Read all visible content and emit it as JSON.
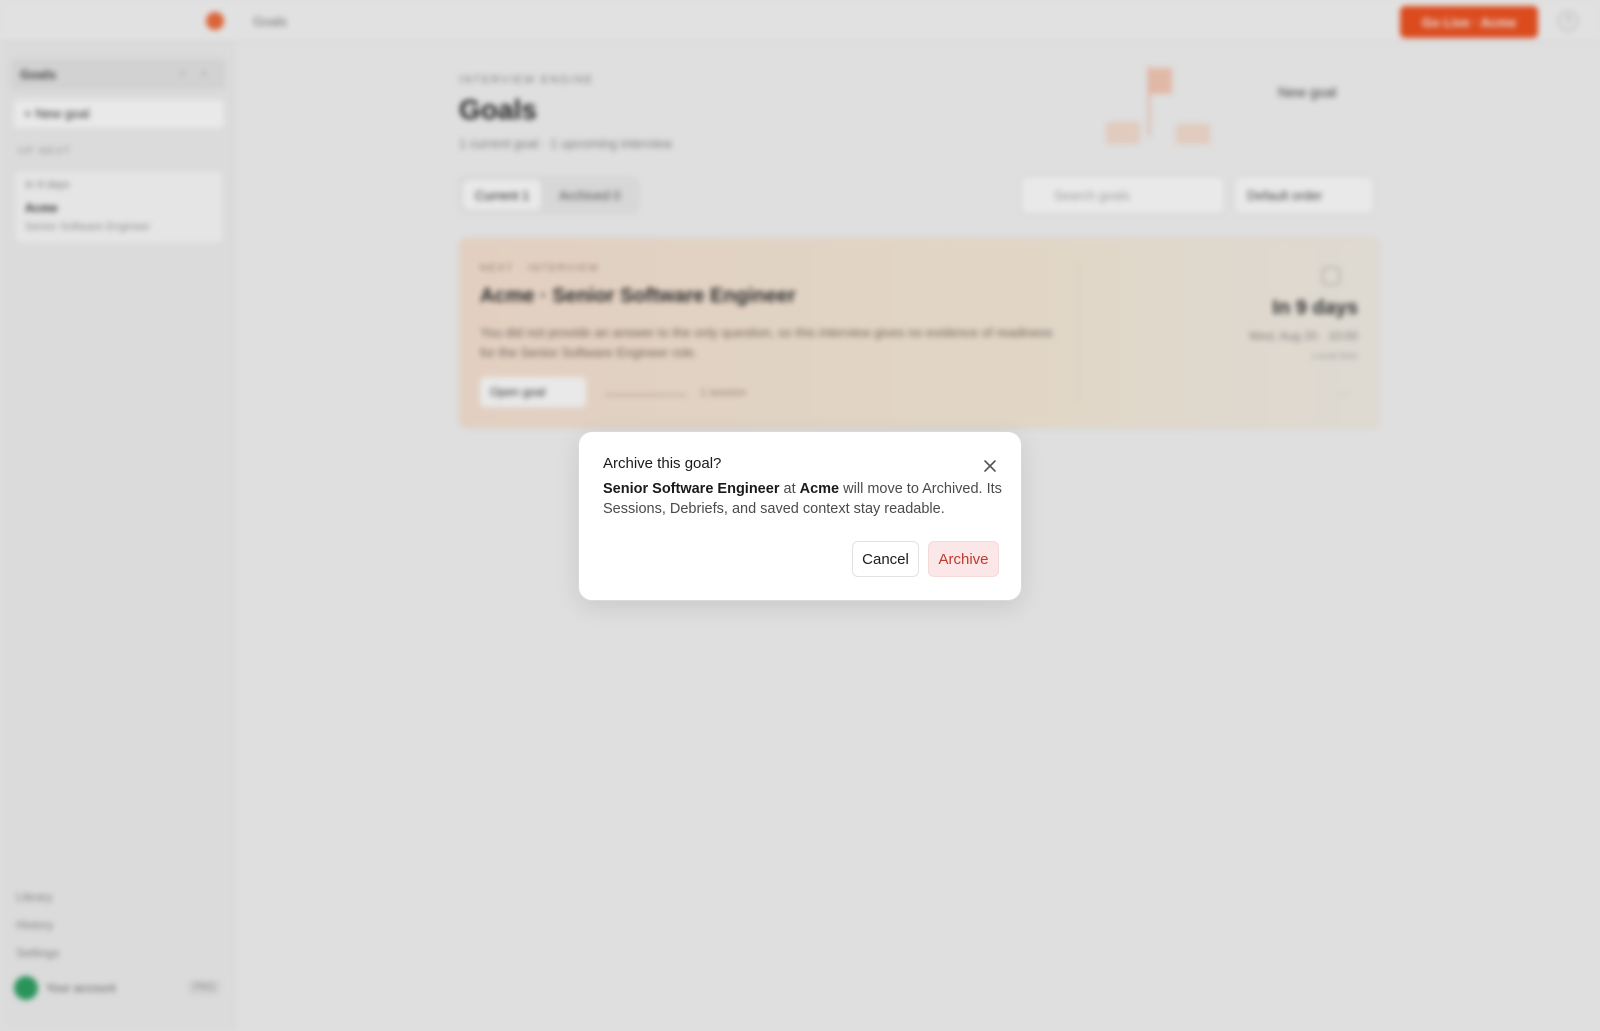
{
  "topbar": {
    "breadcrumb": "Goals",
    "cta_label": "Go Live · Acme",
    "help_icon": "?"
  },
  "sidebar": {
    "header_title": "Goals",
    "new_goal": "+ New goal",
    "section_label": "UP NEXT",
    "card": {
      "days": "In 9 days",
      "company": "Acme",
      "role": "Senior Software Engineer"
    },
    "footer_items": [
      {
        "label": "Library"
      },
      {
        "label": "History"
      },
      {
        "label": "Settings"
      }
    ],
    "account": {
      "name": "Your account",
      "badge": "PRO"
    }
  },
  "main": {
    "eyebrow": "INTERVIEW ENGINE",
    "title": "Goals",
    "subtitle": "1 current goal · 1 upcoming interview",
    "new_goal_link": "New goal",
    "tabs": [
      {
        "label": "Current  1",
        "active": true
      },
      {
        "label": "Archived  0",
        "active": false
      }
    ],
    "search_placeholder": "Search goals",
    "order_label": "Default order",
    "goal_card": {
      "eyebrow": "NEXT · INTERVIEW",
      "title": "Acme · Senior Software Engineer",
      "description": "You did not provide an answer to the only question, so this interview gives no evidence of readiness for the Senior Software Engineer role.",
      "open_label": "Open goal",
      "sessions": "1 session",
      "countdown": "In 9 days",
      "when": "Wed, Aug 20 · 10:00",
      "tz": "Local time"
    }
  },
  "modal": {
    "title": "Archive this goal?",
    "role": "Senior Software Engineer",
    "at": "at",
    "company": "Acme",
    "rest": "will move to Archived. Its Sessions, Debriefs, and saved context stay readable.",
    "cancel_label": "Cancel",
    "archive_label": "Archive"
  },
  "colors": {
    "accent": "#f0501e",
    "danger_text": "#c0392b",
    "danger_bg": "#fbe7e7"
  }
}
